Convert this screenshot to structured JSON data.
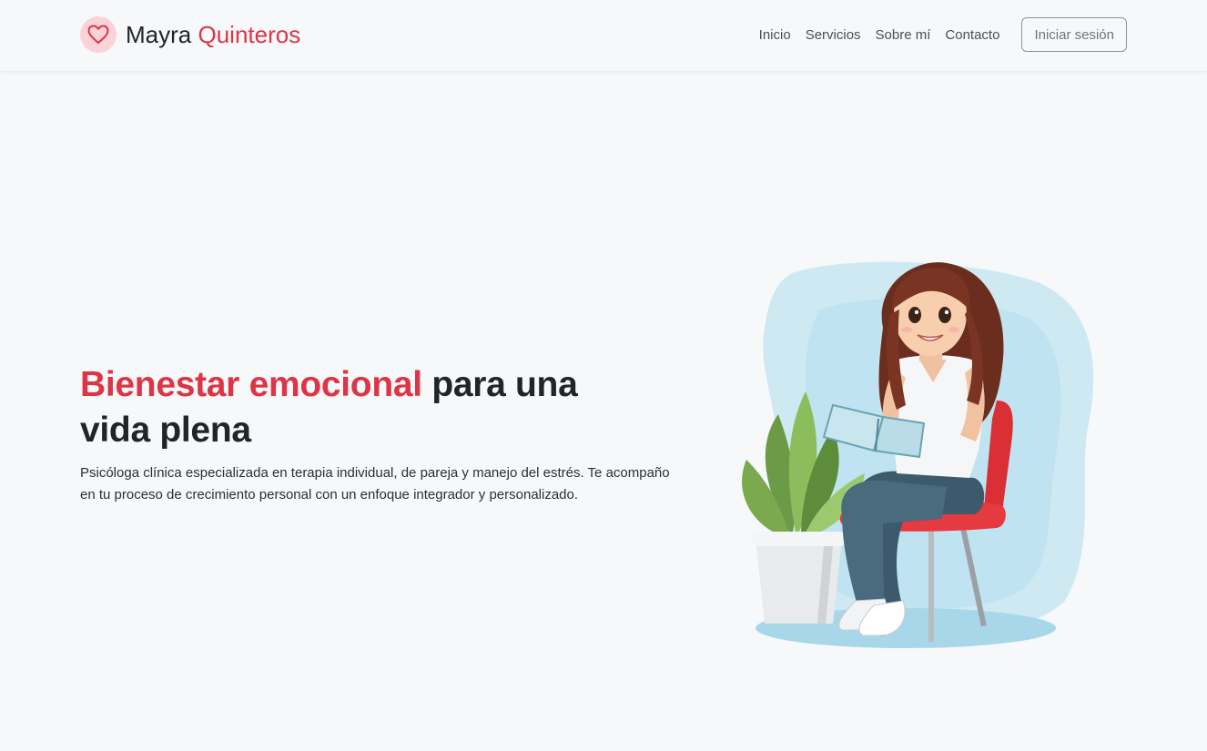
{
  "brand": {
    "first_name": "Mayra",
    "last_name": "Quinteros",
    "icon": "heart-icon",
    "accent_color": "#dc3545"
  },
  "nav": {
    "items": [
      {
        "label": "Inicio"
      },
      {
        "label": "Servicios"
      },
      {
        "label": "Sobre mí"
      },
      {
        "label": "Contacto"
      }
    ],
    "login_label": "Iniciar sesión"
  },
  "hero": {
    "title_accent": "Bienestar emocional",
    "title_rest_1": " para una",
    "title_rest_2": "vida plena",
    "description": "Psicóloga clínica especializada en terapia individual, de pareja y manejo del estrés. Te acompaño en tu proceso de crecimiento personal con un enfoque integrador y personalizado."
  }
}
